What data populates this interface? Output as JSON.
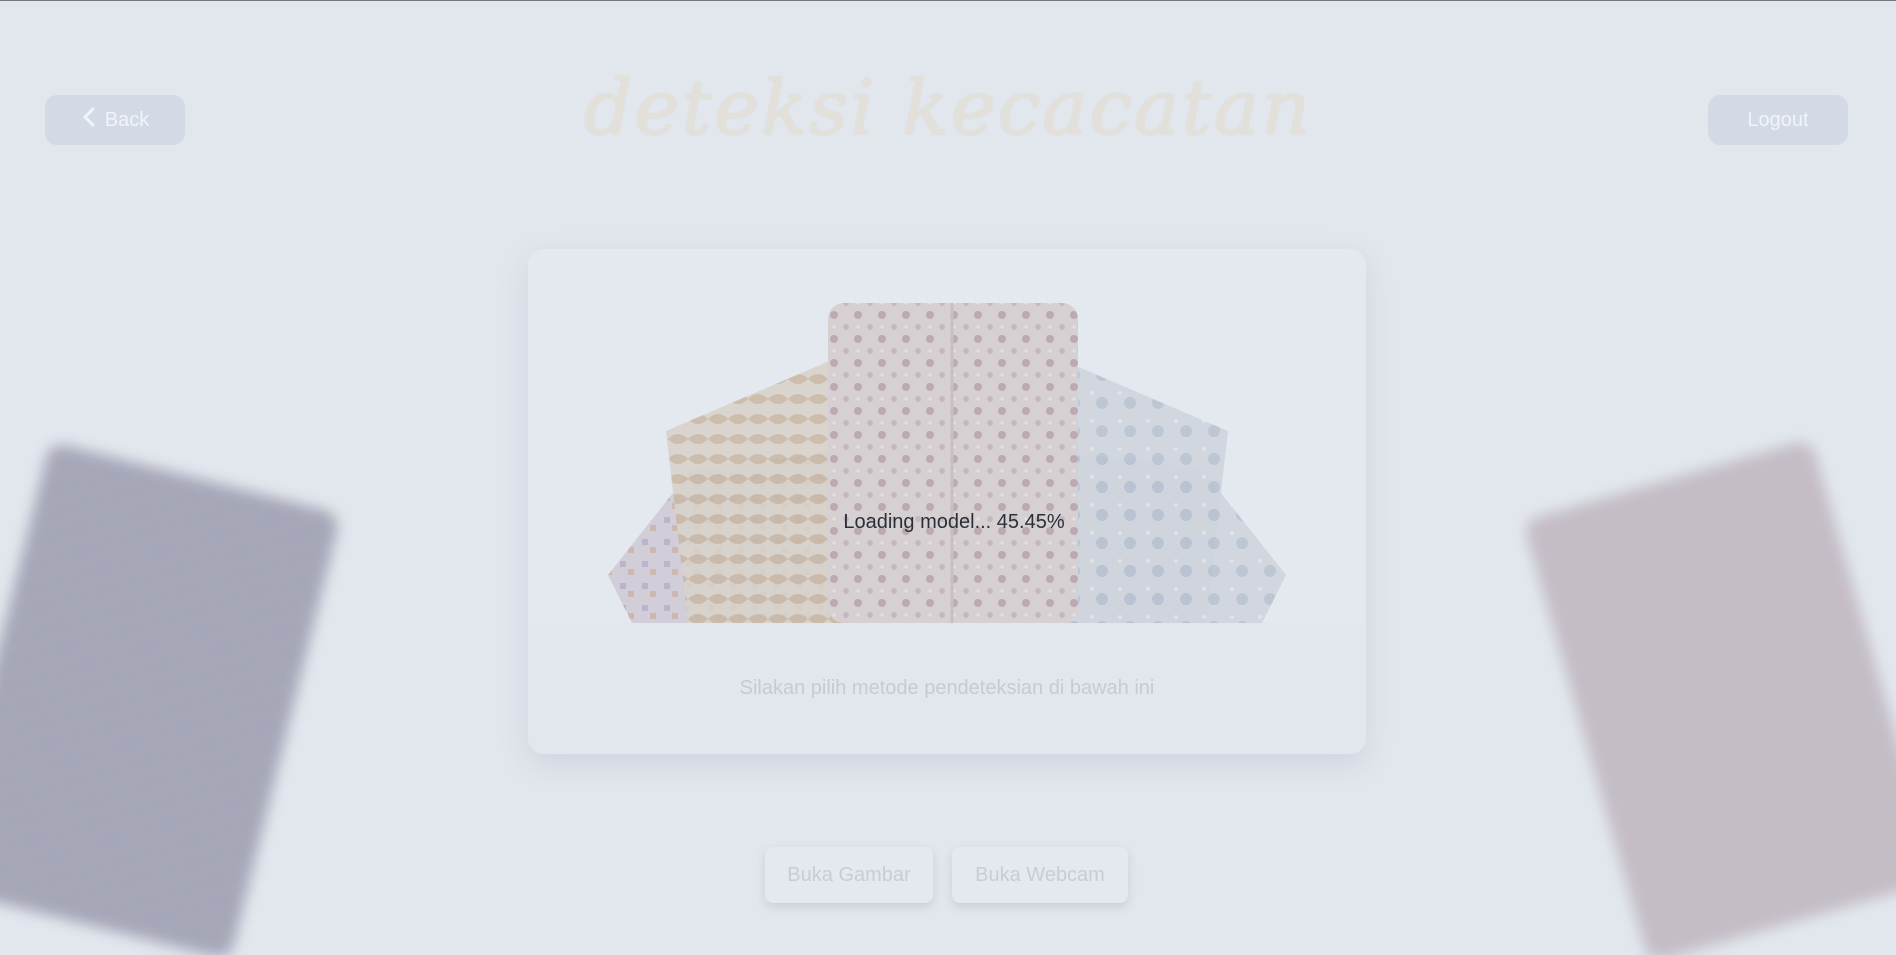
{
  "header": {
    "back_label": "Back",
    "logout_label": "Logout",
    "title": "deteksi kecacatan"
  },
  "main": {
    "loading_text": "Loading model... 45.45%",
    "loading_progress_percent": 45.45,
    "subtitle": "Silakan pilih metode pendeteksian di bawah ini"
  },
  "actions": {
    "open_image_label": "Buka Gambar",
    "open_webcam_label": "Buka Webcam"
  },
  "icons": {
    "back": "chevron-left-icon",
    "loading": "spinner-icon"
  },
  "colors": {
    "background": "#e2e7ee",
    "button_bg": "#d3dae6",
    "spinner": "#1f2937"
  }
}
